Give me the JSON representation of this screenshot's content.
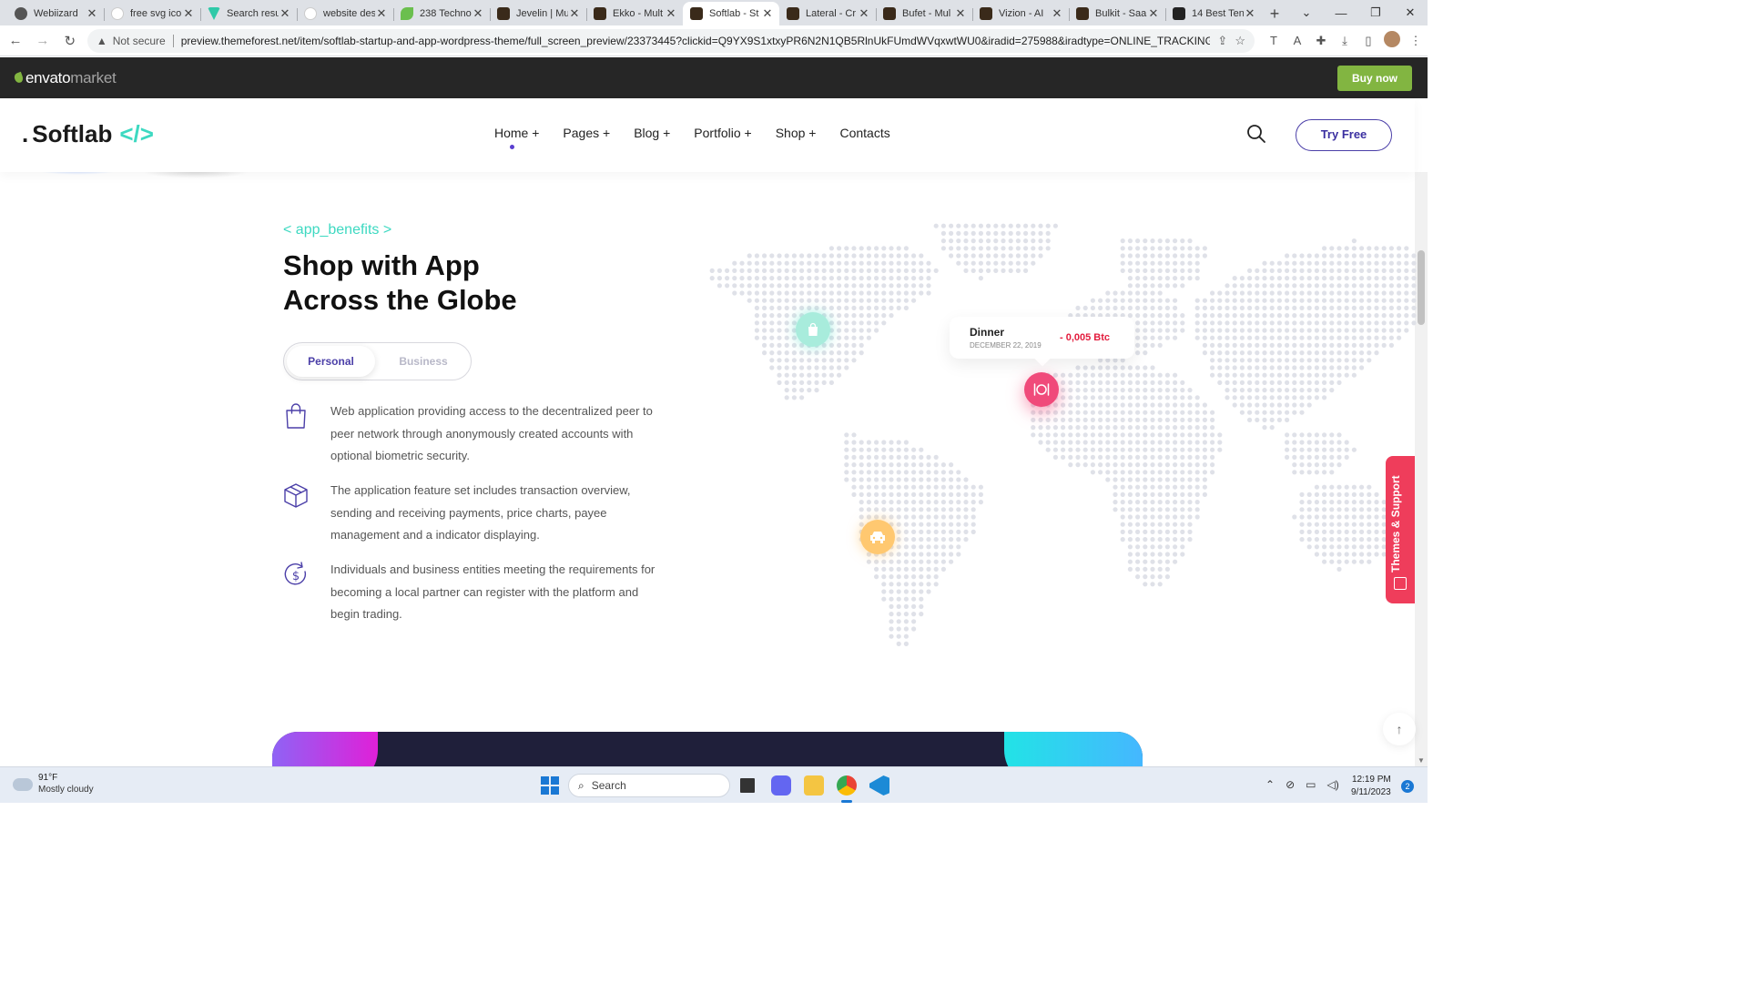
{
  "browser": {
    "tabs": [
      {
        "title": "Webiizard",
        "favicon": "fav-w"
      },
      {
        "title": "free svg ico",
        "favicon": "fav-g"
      },
      {
        "title": "Search resu",
        "favicon": "fav-v"
      },
      {
        "title": "website des",
        "favicon": "fav-g"
      },
      {
        "title": "238 Techno",
        "favicon": "fav-leaf"
      },
      {
        "title": "Jevelin | Mu",
        "favicon": "fav-e"
      },
      {
        "title": "Ekko - Mult",
        "favicon": "fav-e"
      },
      {
        "title": "Softlab - St",
        "favicon": "fav-e",
        "active": true
      },
      {
        "title": "Lateral - Cr",
        "favicon": "fav-e"
      },
      {
        "title": "Bufet - Mul",
        "favicon": "fav-e"
      },
      {
        "title": "Vizion - AI",
        "favicon": "fav-e"
      },
      {
        "title": "Bulkit - Saa",
        "favicon": "fav-e"
      },
      {
        "title": "14 Best Ten",
        "favicon": "fav-n"
      }
    ],
    "security_label": "Not secure",
    "url": "preview.themeforest.net/item/softlab-startup-and-app-wordpress-theme/full_screen_preview/23373445?clickid=Q9YX9S1xtxyPR6N2N1QB5RlnUkFUmdWVqxwtWU0&iradid=275988&iradtype=ONLINE_TRACKING_LINK&irg..."
  },
  "envato": {
    "logo_main": "envato",
    "logo_sub": "market",
    "buy_now": "Buy now"
  },
  "site": {
    "brand_dot": ".",
    "brand_name": "Softlab",
    "brand_code": "</>",
    "nav": [
      "Home +",
      "Pages +",
      "Blog +",
      "Portfolio +",
      "Shop +",
      "Contacts"
    ],
    "try_free": "Try Free"
  },
  "benefits_section": {
    "tag": "< app_benefits >",
    "title_line1": "Shop with App",
    "title_line2": "Across the Globe",
    "toggle": {
      "personal": "Personal",
      "business": "Business",
      "selected": "Personal"
    },
    "items": [
      {
        "icon": "shopping-bag-icon",
        "text": "Web application providing access to the decentralized peer to peer network through anonymously created accounts with optional biometric security."
      },
      {
        "icon": "box-icon",
        "text": "The application feature set includes transaction overview, sending and receiving payments, price charts, payee management and a indicator displaying."
      },
      {
        "icon": "dollar-cycle-icon",
        "text": "Individuals and business entities meeting the requirements for becoming a local partner can register with the platform and begin trading."
      }
    ],
    "map_tooltip": {
      "title": "Dinner",
      "date": "DECEMBER 22, 2019",
      "amount": "- 0,005 Btc"
    },
    "colors": {
      "accent_teal": "#3dd9c1",
      "accent_purple": "#4b3fa8",
      "pin_pink": "#f04a7a",
      "amount_red": "#e31c3d"
    }
  },
  "support_tab": "Themes & Support",
  "taskbar": {
    "weather_temp": "91°F",
    "weather_desc": "Mostly cloudy",
    "search_placeholder": "Search",
    "time": "12:19 PM",
    "date": "9/11/2023",
    "notifications": "2"
  }
}
